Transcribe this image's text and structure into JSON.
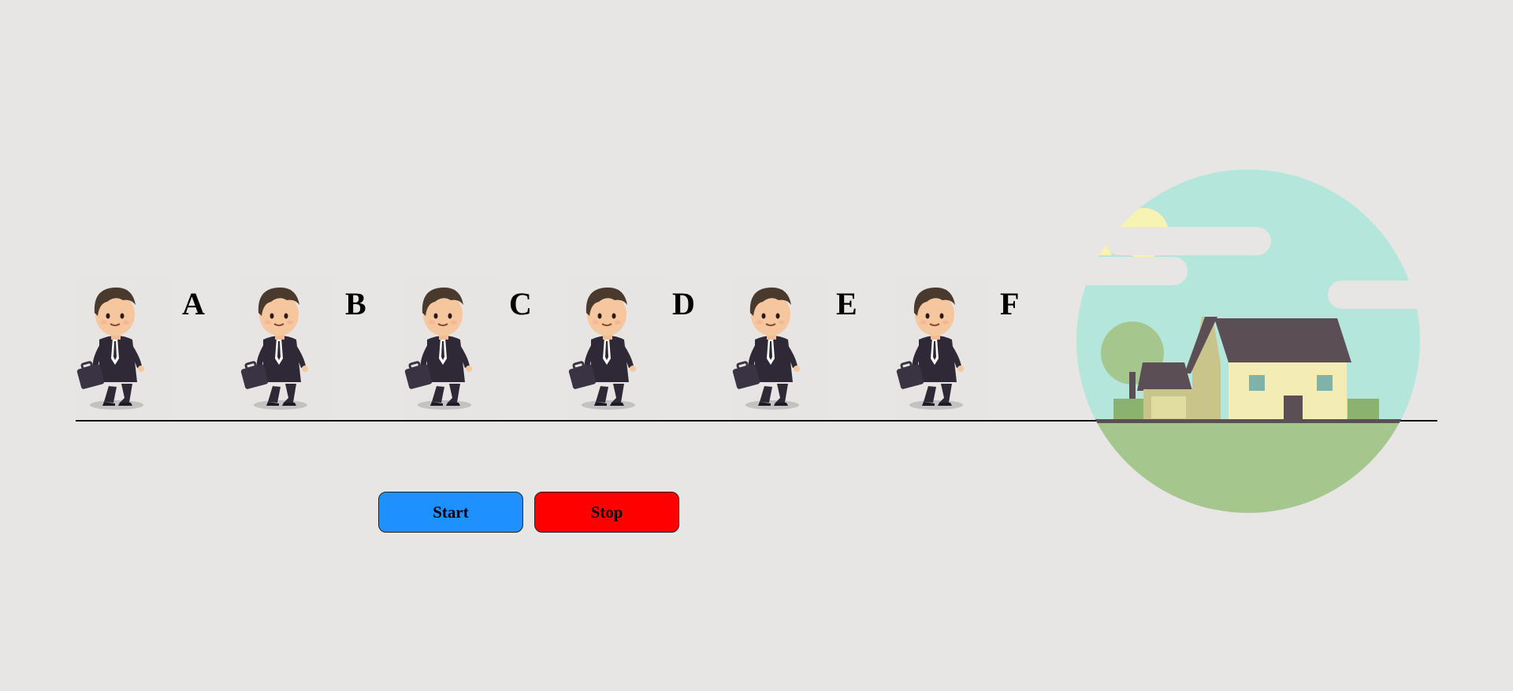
{
  "runners": [
    {
      "label": "A"
    },
    {
      "label": "B"
    },
    {
      "label": "C"
    },
    {
      "label": "D"
    },
    {
      "label": "E"
    },
    {
      "label": "F"
    }
  ],
  "controls": {
    "start_label": "Start",
    "stop_label": "Stop"
  },
  "colors": {
    "background": "#e8e6e4",
    "start_button": "#1e90ff",
    "stop_button": "#ff0000",
    "sky": "#b5e6dc",
    "grass": "#a5c78e",
    "roof": "#5b4e55",
    "wall": "#f3edb5",
    "suit": "#2f2937"
  },
  "icons": {
    "runner": "businessman-walking-icon",
    "destination": "house-scene-icon"
  }
}
